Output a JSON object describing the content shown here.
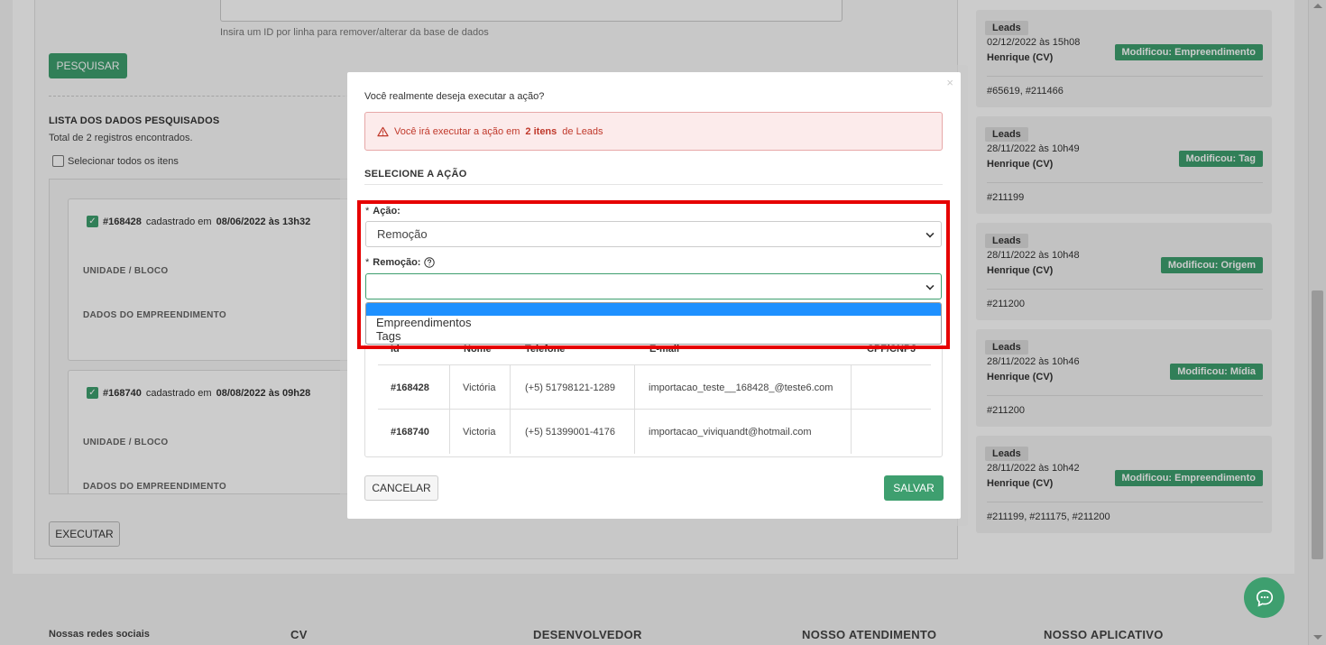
{
  "search": {
    "help": "Insira um ID por linha para remover/alterar da base de dados",
    "button": "PESQUISAR"
  },
  "list": {
    "title": "LISTA DOS DADOS PESQUISADOS",
    "total": "Total de 2 registros encontrados.",
    "select_all": "Selecionar todos os itens",
    "records": [
      {
        "id": "#168428",
        "mid": "cadastrado em",
        "date": "08/06/2022 às 13h32",
        "unit_label": "UNIDADE / BLOCO",
        "emp_label": "DADOS DO EMPREENDIMENTO"
      },
      {
        "id": "#168740",
        "mid": "cadastrado em",
        "date": "08/08/2022 às 09h28",
        "unit_label": "UNIDADE / BLOCO",
        "emp_label": "DADOS DO EMPREENDIMENTO"
      }
    ],
    "execute": "EXECUTAR"
  },
  "activity": [
    {
      "tag": "Leads",
      "date": "02/12/2022 às 15h08",
      "author": "Henrique (CV)",
      "chip": "Modificou: Empreendimento",
      "ids": "#65619, #211466"
    },
    {
      "tag": "Leads",
      "date": "28/11/2022 às 10h49",
      "author": "Henrique (CV)",
      "chip": "Modificou: Tag",
      "ids": "#211199"
    },
    {
      "tag": "Leads",
      "date": "28/11/2022 às 10h48",
      "author": "Henrique (CV)",
      "chip": "Modificou: Origem",
      "ids": "#211200"
    },
    {
      "tag": "Leads",
      "date": "28/11/2022 às 10h46",
      "author": "Henrique (CV)",
      "chip": "Modificou: Mídia",
      "ids": "#211200"
    },
    {
      "tag": "Leads",
      "date": "28/11/2022 às 10h42",
      "author": "Henrique (CV)",
      "chip": "Modificou: Empreendimento",
      "ids": "#211199, #211175, #211200"
    }
  ],
  "footer": {
    "social": "Nossas redes sociais",
    "cv": "CV",
    "dev": "DESENVOLVEDOR",
    "support": "NOSSO ATENDIMENTO",
    "app": "NOSSO APLICATIVO"
  },
  "modal": {
    "close": "×",
    "question": "Você realmente deseja executar a ação?",
    "alert_pre": "Você irá executar a ação em",
    "alert_count": "2 itens",
    "alert_post": "de Leads",
    "section_title": "SELECIONE A AÇÃO",
    "action_star": "*",
    "action_label": "Ação:",
    "action_value": "Remoção",
    "removal_star": "*",
    "removal_label": "Remoção:",
    "removal_value": "",
    "dropdown_options": [
      "Empreendimentos",
      "Tags"
    ],
    "table_headers": [
      "Id",
      "Nome",
      "Telefone",
      "E-mail",
      "CPF/CNPJ"
    ],
    "rows": [
      {
        "id": "#168428",
        "name": "Victória",
        "phone": "(+5) 51798121-1289",
        "email": "importacao_teste__168428_@teste6.com",
        "doc": ""
      },
      {
        "id": "#168740",
        "name": "Victoria",
        "phone": "(+5) 51399001-4176",
        "email": "importacao_viviquandt@hotmail.com",
        "doc": ""
      }
    ],
    "cancel": "CANCELAR",
    "save": "SALVAR"
  },
  "colors": {
    "primary_green": "#3e9f6f",
    "alert_red": "#c0392b",
    "highlight_red": "#e60000",
    "dropdown_selected": "#1e90ff"
  },
  "icons": {
    "alert": "warning-triangle-icon",
    "help": "question-circle-icon",
    "chat": "chat-bubble-icon"
  }
}
